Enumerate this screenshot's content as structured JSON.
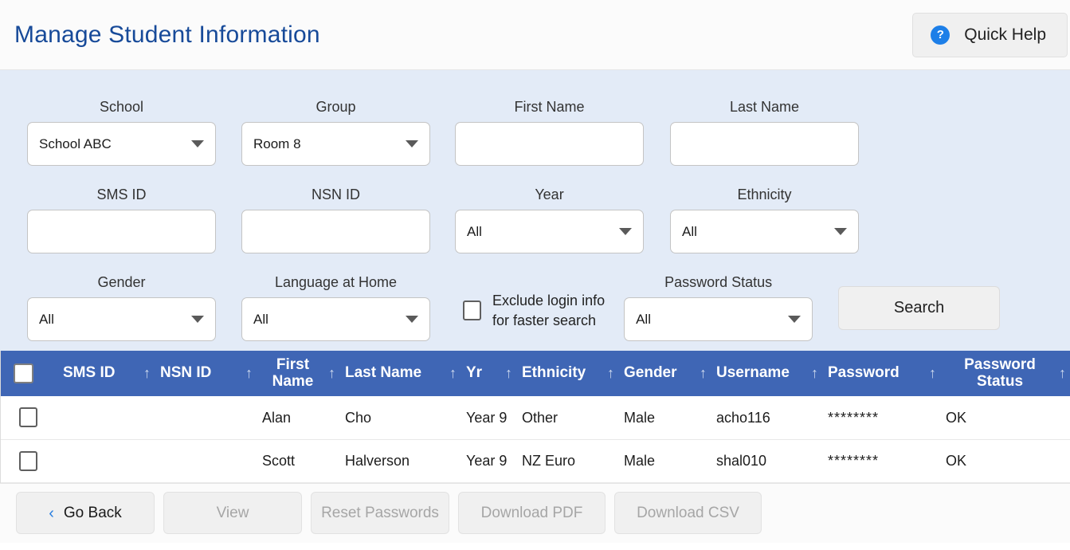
{
  "header": {
    "title": "Manage Student Information",
    "quick_help": {
      "label": "Quick Help",
      "icon": "help-circle-icon",
      "glyph": "?"
    }
  },
  "filters": {
    "school": {
      "label": "School",
      "type": "select",
      "value": "School ABC"
    },
    "group": {
      "label": "Group",
      "type": "select",
      "value": "Room 8"
    },
    "first_name": {
      "label": "First Name",
      "type": "text",
      "value": "",
      "placeholder": ""
    },
    "last_name": {
      "label": "Last Name",
      "type": "text",
      "value": "",
      "placeholder": ""
    },
    "sms_id": {
      "label": "SMS ID",
      "type": "text",
      "value": "",
      "placeholder": ""
    },
    "nsn_id": {
      "label": "NSN ID",
      "type": "text",
      "value": "",
      "placeholder": ""
    },
    "year": {
      "label": "Year",
      "type": "select",
      "value": "All"
    },
    "ethnicity": {
      "label": "Ethnicity",
      "type": "select",
      "value": "All"
    },
    "gender": {
      "label": "Gender",
      "type": "select",
      "value": "All"
    },
    "language_at_home": {
      "label": "Language at Home",
      "type": "select",
      "value": "All"
    },
    "exclude_login": {
      "line1": "Exclude login info",
      "line2": "for faster search",
      "checked": false
    },
    "password_status": {
      "label": "Password Status",
      "type": "select",
      "value": "All"
    },
    "search_button": {
      "label": "Search"
    }
  },
  "table": {
    "select_all_checked": false,
    "sort_glyph": "↑",
    "columns": [
      {
        "key": "select",
        "label": ""
      },
      {
        "key": "sms_id",
        "label": "SMS ID"
      },
      {
        "key": "nsn_id",
        "label": "NSN ID"
      },
      {
        "key": "first_name",
        "label": "First Name"
      },
      {
        "key": "last_name",
        "label": "Last Name"
      },
      {
        "key": "yr",
        "label": "Yr"
      },
      {
        "key": "ethnicity",
        "label": "Ethnicity"
      },
      {
        "key": "gender",
        "label": "Gender"
      },
      {
        "key": "username",
        "label": "Username"
      },
      {
        "key": "password",
        "label": "Password"
      },
      {
        "key": "password_status",
        "label": "Password Status"
      }
    ],
    "rows": [
      {
        "checked": false,
        "sms_id": "",
        "nsn_id": "",
        "first_name": "Alan",
        "last_name": "Cho",
        "yr": "Year 9",
        "ethnicity": "Other",
        "gender": "Male",
        "username": "acho116",
        "password": "********",
        "password_status": "OK"
      },
      {
        "checked": false,
        "sms_id": "",
        "nsn_id": "",
        "first_name": "Scott",
        "last_name": "Halverson",
        "yr": "Year 9",
        "ethnicity": "NZ Euro",
        "gender": "Male",
        "username": "shal010",
        "password": "********",
        "password_status": "OK"
      }
    ]
  },
  "footer": {
    "go_back": {
      "label": "Go Back",
      "enabled": true,
      "icon": "chevron-left-icon",
      "glyph": "‹"
    },
    "view": {
      "label": "View",
      "enabled": false
    },
    "reset_passwords": {
      "label": "Reset Passwords",
      "enabled": false
    },
    "download_pdf": {
      "label": "Download PDF",
      "enabled": false
    },
    "download_csv": {
      "label": "Download CSV",
      "enabled": false
    }
  },
  "colors": {
    "title_blue": "#174a99",
    "panel_bg": "#e3ebf7",
    "table_header_blue": "#3f66b5",
    "accent_blue": "#1d7fe8"
  }
}
